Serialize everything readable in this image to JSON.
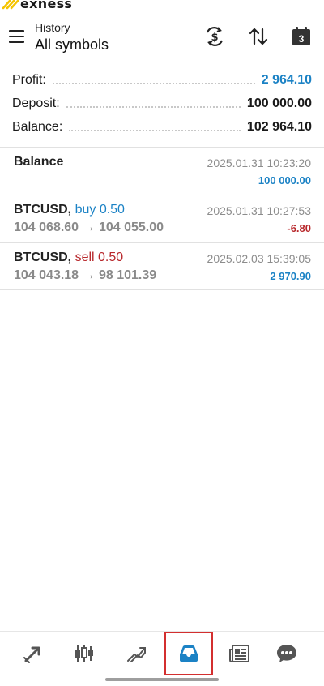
{
  "brand": {
    "name": "exness",
    "accent": "#f5c400"
  },
  "header": {
    "subtitle": "History",
    "title": "All symbols",
    "calendar_day": "3",
    "icons": [
      "menu-icon",
      "currency-exchange-icon",
      "sort-icon",
      "calendar-icon"
    ]
  },
  "summary": {
    "profit": {
      "label": "Profit:",
      "value": "2 964.10"
    },
    "deposit": {
      "label": "Deposit:",
      "value": "100 000.00"
    },
    "balance": {
      "label": "Balance:",
      "value": "102 964.10"
    }
  },
  "history": [
    {
      "symbol": "Balance",
      "side": "",
      "volume": "",
      "prices": "",
      "time": "2025.01.31 10:23:20",
      "amount": "100 000.00"
    },
    {
      "symbol": "BTCUSD,",
      "side": "buy",
      "volume": "0.50",
      "prices": "104 068.60 → 104 055.00",
      "time": "2025.01.31 10:27:53",
      "amount": "-6.80"
    },
    {
      "symbol": "BTCUSD,",
      "side": "sell",
      "volume": "0.50",
      "prices": "104 043.18 → 98 101.39",
      "time": "2025.02.03 15:39:05",
      "amount": "2 970.90"
    }
  ],
  "nav": {
    "items": [
      "quotes-icon",
      "chart-icon",
      "trade-icon",
      "history-icon",
      "news-icon",
      "chat-icon"
    ],
    "active": "history-icon"
  },
  "colors": {
    "positive": "#1b82c5",
    "negative": "#b8282c",
    "buy": "#1b82c5",
    "sell": "#b8282c",
    "active_outline": "#d32f2f"
  }
}
